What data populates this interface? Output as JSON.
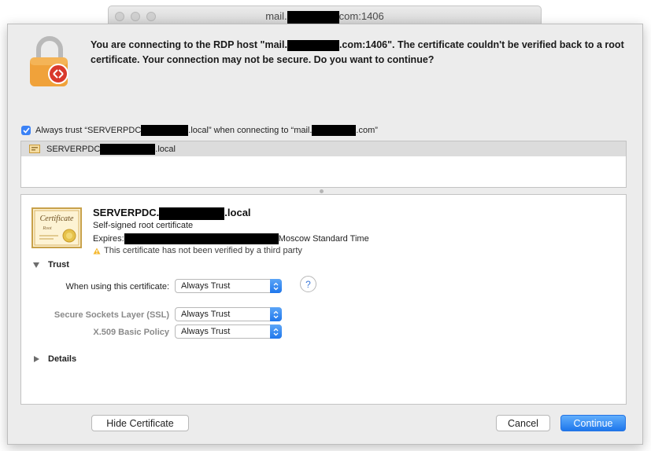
{
  "window": {
    "title_prefix": "mail.",
    "title_suffix": "com:1406"
  },
  "dialog": {
    "message": "You are connecting to the RDP host \"mail.",
    "message_mid": ".com:1406\". The certificate couldn't be verified back to a root certificate. Your connection may not be secure. Do you want to continue?",
    "always_trust": {
      "checked": true,
      "text_a": "Always trust “SERVERPDC",
      "text_b": ".local” when connecting to “mail.",
      "text_c": ".com”"
    },
    "cert_list": {
      "item_prefix": "SERVERPDC",
      "item_suffix": ".local"
    },
    "certificate": {
      "name_prefix": "SERVERPDC.",
      "name_suffix": ".local",
      "type": "Self-signed root certificate",
      "expires_label": "Expires:",
      "expires_tz": "Moscow Standard Time",
      "warning": "This certificate has not been verified by a third party",
      "image_script": "Certificate",
      "image_sub": "Root"
    },
    "trust": {
      "section_label": "Trust",
      "when_using_label": "When using this certificate:",
      "when_using_value": "Always Trust",
      "ssl_label": "Secure Sockets Layer (SSL)",
      "ssl_value": "Always Trust",
      "x509_label": "X.509 Basic Policy",
      "x509_value": "Always Trust",
      "help": "?"
    },
    "details_label": "Details",
    "buttons": {
      "hide_certificate": "Hide Certificate",
      "cancel": "Cancel",
      "continue": "Continue"
    }
  },
  "colors": {
    "accent": "#1e77ec",
    "checkbox": "#3b82f6",
    "lock_body": "#f0a23a",
    "rdp_badge": "#d9392c"
  }
}
